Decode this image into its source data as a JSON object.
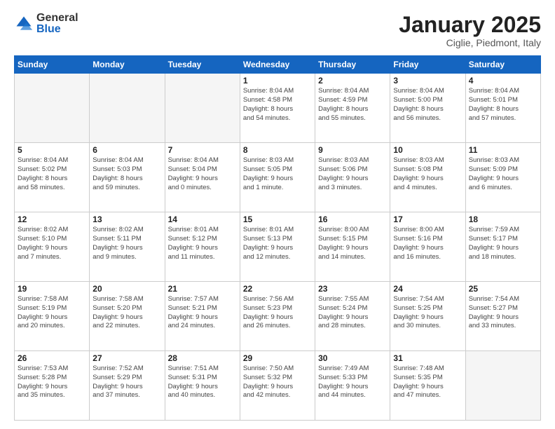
{
  "logo": {
    "general": "General",
    "blue": "Blue"
  },
  "header": {
    "month": "January 2025",
    "location": "Ciglie, Piedmont, Italy"
  },
  "weekdays": [
    "Sunday",
    "Monday",
    "Tuesday",
    "Wednesday",
    "Thursday",
    "Friday",
    "Saturday"
  ],
  "weeks": [
    [
      {
        "day": "",
        "info": "",
        "empty": true
      },
      {
        "day": "",
        "info": "",
        "empty": true
      },
      {
        "day": "",
        "info": "",
        "empty": true
      },
      {
        "day": "1",
        "info": "Sunrise: 8:04 AM\nSunset: 4:58 PM\nDaylight: 8 hours\nand 54 minutes."
      },
      {
        "day": "2",
        "info": "Sunrise: 8:04 AM\nSunset: 4:59 PM\nDaylight: 8 hours\nand 55 minutes."
      },
      {
        "day": "3",
        "info": "Sunrise: 8:04 AM\nSunset: 5:00 PM\nDaylight: 8 hours\nand 56 minutes."
      },
      {
        "day": "4",
        "info": "Sunrise: 8:04 AM\nSunset: 5:01 PM\nDaylight: 8 hours\nand 57 minutes."
      }
    ],
    [
      {
        "day": "5",
        "info": "Sunrise: 8:04 AM\nSunset: 5:02 PM\nDaylight: 8 hours\nand 58 minutes."
      },
      {
        "day": "6",
        "info": "Sunrise: 8:04 AM\nSunset: 5:03 PM\nDaylight: 8 hours\nand 59 minutes."
      },
      {
        "day": "7",
        "info": "Sunrise: 8:04 AM\nSunset: 5:04 PM\nDaylight: 9 hours\nand 0 minutes."
      },
      {
        "day": "8",
        "info": "Sunrise: 8:03 AM\nSunset: 5:05 PM\nDaylight: 9 hours\nand 1 minute."
      },
      {
        "day": "9",
        "info": "Sunrise: 8:03 AM\nSunset: 5:06 PM\nDaylight: 9 hours\nand 3 minutes."
      },
      {
        "day": "10",
        "info": "Sunrise: 8:03 AM\nSunset: 5:08 PM\nDaylight: 9 hours\nand 4 minutes."
      },
      {
        "day": "11",
        "info": "Sunrise: 8:03 AM\nSunset: 5:09 PM\nDaylight: 9 hours\nand 6 minutes."
      }
    ],
    [
      {
        "day": "12",
        "info": "Sunrise: 8:02 AM\nSunset: 5:10 PM\nDaylight: 9 hours\nand 7 minutes."
      },
      {
        "day": "13",
        "info": "Sunrise: 8:02 AM\nSunset: 5:11 PM\nDaylight: 9 hours\nand 9 minutes."
      },
      {
        "day": "14",
        "info": "Sunrise: 8:01 AM\nSunset: 5:12 PM\nDaylight: 9 hours\nand 11 minutes."
      },
      {
        "day": "15",
        "info": "Sunrise: 8:01 AM\nSunset: 5:13 PM\nDaylight: 9 hours\nand 12 minutes."
      },
      {
        "day": "16",
        "info": "Sunrise: 8:00 AM\nSunset: 5:15 PM\nDaylight: 9 hours\nand 14 minutes."
      },
      {
        "day": "17",
        "info": "Sunrise: 8:00 AM\nSunset: 5:16 PM\nDaylight: 9 hours\nand 16 minutes."
      },
      {
        "day": "18",
        "info": "Sunrise: 7:59 AM\nSunset: 5:17 PM\nDaylight: 9 hours\nand 18 minutes."
      }
    ],
    [
      {
        "day": "19",
        "info": "Sunrise: 7:58 AM\nSunset: 5:19 PM\nDaylight: 9 hours\nand 20 minutes."
      },
      {
        "day": "20",
        "info": "Sunrise: 7:58 AM\nSunset: 5:20 PM\nDaylight: 9 hours\nand 22 minutes."
      },
      {
        "day": "21",
        "info": "Sunrise: 7:57 AM\nSunset: 5:21 PM\nDaylight: 9 hours\nand 24 minutes."
      },
      {
        "day": "22",
        "info": "Sunrise: 7:56 AM\nSunset: 5:23 PM\nDaylight: 9 hours\nand 26 minutes."
      },
      {
        "day": "23",
        "info": "Sunrise: 7:55 AM\nSunset: 5:24 PM\nDaylight: 9 hours\nand 28 minutes."
      },
      {
        "day": "24",
        "info": "Sunrise: 7:54 AM\nSunset: 5:25 PM\nDaylight: 9 hours\nand 30 minutes."
      },
      {
        "day": "25",
        "info": "Sunrise: 7:54 AM\nSunset: 5:27 PM\nDaylight: 9 hours\nand 33 minutes."
      }
    ],
    [
      {
        "day": "26",
        "info": "Sunrise: 7:53 AM\nSunset: 5:28 PM\nDaylight: 9 hours\nand 35 minutes."
      },
      {
        "day": "27",
        "info": "Sunrise: 7:52 AM\nSunset: 5:29 PM\nDaylight: 9 hours\nand 37 minutes."
      },
      {
        "day": "28",
        "info": "Sunrise: 7:51 AM\nSunset: 5:31 PM\nDaylight: 9 hours\nand 40 minutes."
      },
      {
        "day": "29",
        "info": "Sunrise: 7:50 AM\nSunset: 5:32 PM\nDaylight: 9 hours\nand 42 minutes."
      },
      {
        "day": "30",
        "info": "Sunrise: 7:49 AM\nSunset: 5:33 PM\nDaylight: 9 hours\nand 44 minutes."
      },
      {
        "day": "31",
        "info": "Sunrise: 7:48 AM\nSunset: 5:35 PM\nDaylight: 9 hours\nand 47 minutes."
      },
      {
        "day": "",
        "info": "",
        "empty": true
      }
    ]
  ]
}
